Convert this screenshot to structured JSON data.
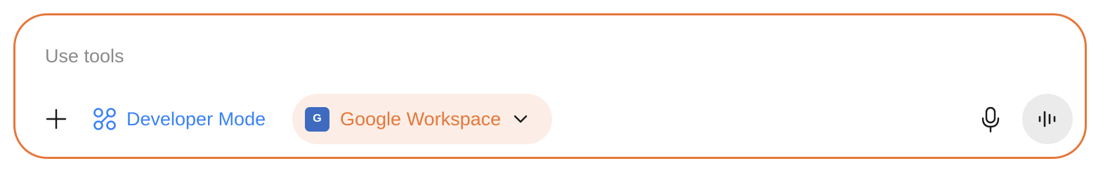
{
  "composer": {
    "placeholder": "Use tools",
    "value": ""
  },
  "toolbar": {
    "add_icon": "plus-icon",
    "developer_mode": {
      "label": "Developer Mode",
      "icon": "nodes-icon",
      "color": "#3B82F6"
    },
    "workspace_chip": {
      "badge": "G",
      "label": "Google Workspace",
      "icon": "chevron-down-icon",
      "accent": "#E5773B",
      "background": "#FCEEE6",
      "badge_color": "#3E6BC0"
    },
    "mic_icon": "microphone-icon",
    "voice_icon": "voice-waveform-icon"
  },
  "colors": {
    "border": "#E5773B"
  }
}
